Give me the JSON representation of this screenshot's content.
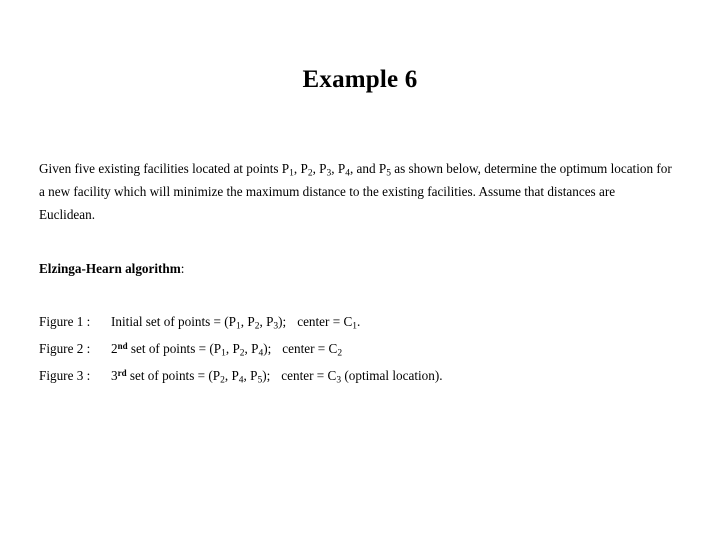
{
  "slide": {
    "title": "Example 6",
    "paragraph": {
      "part1": "Given five existing facilities located at points P",
      "sub1": "1",
      "part2": ", P",
      "sub2": "2",
      "part3": ", P",
      "sub3": "3",
      "part4": ", P",
      "sub4": "4",
      "part5": ", and P",
      "sub5": "5",
      "part6": " as shown below, determine the optimum location for a new facility which will minimize the maximum distance to the existing facilities. Assume that distances are Euclidean."
    },
    "heading": {
      "strong": "Elzinga-Hearn algorithm",
      "colon": ":"
    },
    "figures": [
      {
        "label": "Figure 1 :",
        "desc_prefix": "Initial set of points = (P",
        "ordinal": "",
        "ordinal_sup": "",
        "p_a_sub": "1",
        "mid_a": ", P",
        "p_b_sub": "2",
        "mid_b": ", P",
        "p_c_sub": "3",
        "close": ");",
        "center_text": "center = C",
        "center_sub": "1",
        "tail": "."
      },
      {
        "label": "Figure 2 :",
        "desc_prefix": " set of points = (P",
        "ordinal": "2",
        "ordinal_sup": "nd",
        "p_a_sub": "1",
        "mid_a": ", P",
        "p_b_sub": "2",
        "mid_b": ", P",
        "p_c_sub": "4",
        "close": ");",
        "center_text": "center = C",
        "center_sub": "2",
        "tail": ""
      },
      {
        "label": "Figure 3 :",
        "desc_prefix": " set of points = (P",
        "ordinal": "3",
        "ordinal_sup": "rd",
        "p_a_sub": "2",
        "mid_a": ", P",
        "p_b_sub": "4",
        "mid_b": ", P",
        "p_c_sub": "5",
        "close": ");",
        "center_text": "center = C",
        "center_sub": "3",
        "tail": " (optimal location)."
      }
    ]
  }
}
